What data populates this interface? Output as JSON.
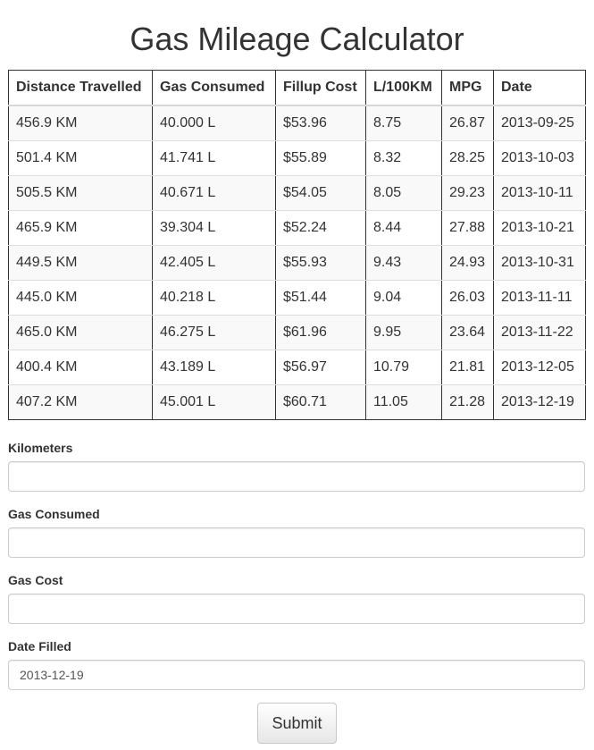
{
  "page": {
    "title": "Gas Mileage Calculator"
  },
  "table": {
    "headers": [
      "Distance Travelled",
      "Gas Consumed",
      "Fillup Cost",
      "L/100KM",
      "MPG",
      "Date"
    ],
    "rows": [
      [
        "456.9 KM",
        "40.000 L",
        "$53.96",
        "8.75",
        "26.87",
        "2013-09-25"
      ],
      [
        "501.4 KM",
        "41.741 L",
        "$55.89",
        "8.32",
        "28.25",
        "2013-10-03"
      ],
      [
        "505.5 KM",
        "40.671 L",
        "$54.05",
        "8.05",
        "29.23",
        "2013-10-11"
      ],
      [
        "465.9 KM",
        "39.304 L",
        "$52.24",
        "8.44",
        "27.88",
        "2013-10-21"
      ],
      [
        "449.5 KM",
        "42.405 L",
        "$55.93",
        "9.43",
        "24.93",
        "2013-10-31"
      ],
      [
        "445.0 KM",
        "40.218 L",
        "$51.44",
        "9.04",
        "26.03",
        "2013-11-11"
      ],
      [
        "465.0 KM",
        "46.275 L",
        "$61.96",
        "9.95",
        "23.64",
        "2013-11-22"
      ],
      [
        "400.4 KM",
        "43.189 L",
        "$56.97",
        "10.79",
        "21.81",
        "2013-12-05"
      ],
      [
        "407.2 KM",
        "45.001 L",
        "$60.71",
        "11.05",
        "21.28",
        "2013-12-19"
      ]
    ]
  },
  "form": {
    "kilometers": {
      "label": "Kilometers",
      "value": ""
    },
    "gas_consumed": {
      "label": "Gas Consumed",
      "value": ""
    },
    "gas_cost": {
      "label": "Gas Cost",
      "value": ""
    },
    "date_filled": {
      "label": "Date Filled",
      "value": "2013-12-19"
    },
    "submit_label": "Submit"
  }
}
